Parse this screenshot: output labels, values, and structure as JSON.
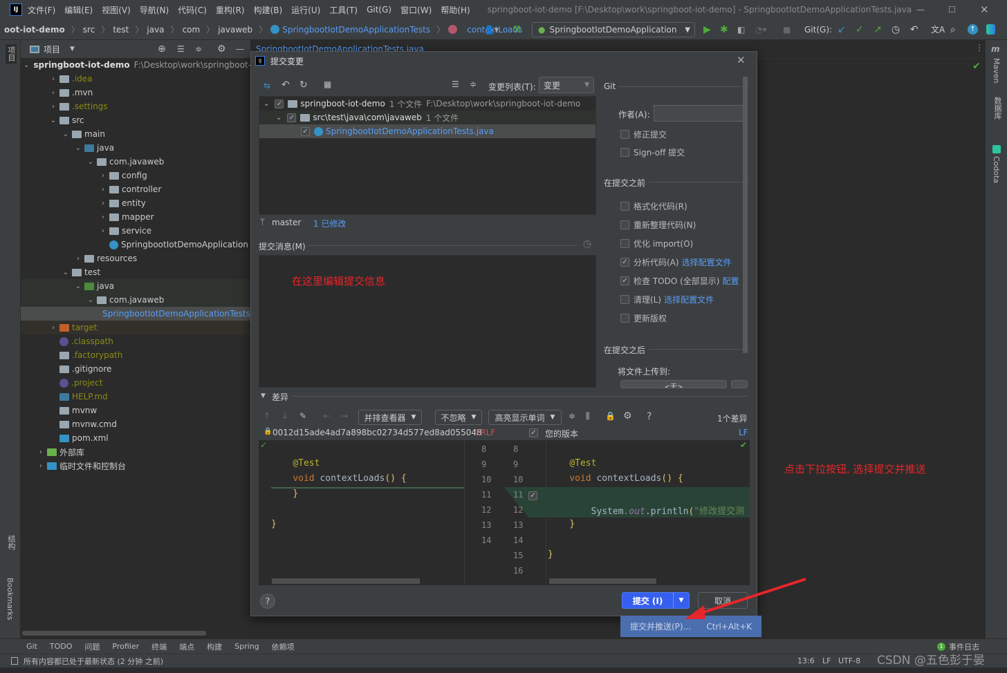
{
  "window": {
    "title": "springboot-iot-demo [F:\\Desktop\\work\\springboot-iot-demo] - SpringbootIotDemoApplicationTests.java",
    "menu": [
      "文件(F)",
      "编辑(E)",
      "视图(V)",
      "导航(N)",
      "代码(C)",
      "重构(R)",
      "构建(B)",
      "运行(U)",
      "工具(T)",
      "Git(G)",
      "窗口(W)",
      "帮助(H)"
    ]
  },
  "breadcrumb": [
    "oot-iot-demo",
    "src",
    "test",
    "java",
    "com",
    "javaweb",
    "SpringbootIotDemoApplicationTests",
    "contextLoads"
  ],
  "toolbar": {
    "run_config": "SpringbootIotDemoApplication",
    "git_label": "Git(G):"
  },
  "left_strip": {
    "project": "项目",
    "structure": "结构",
    "bookmarks": "Bookmarks"
  },
  "right_strip": [
    "Maven",
    "数据库",
    "Codota"
  ],
  "project": {
    "header": "项目",
    "root_name": "springboot-iot-demo",
    "root_path": "F:\\Desktop\\work\\springboot-iot-demo",
    "tree": [
      {
        "l": 1,
        "a": ">",
        "t": ".idea",
        "c": "#8b8b16",
        "i": "folder"
      },
      {
        "l": 1,
        "a": ">",
        "t": ".mvn",
        "c": "#ccc",
        "i": "folder"
      },
      {
        "l": 1,
        "a": ">",
        "t": ".settings",
        "c": "#8b8b16",
        "i": "folder"
      },
      {
        "l": 1,
        "a": "v",
        "t": "src",
        "c": "#ccc",
        "i": "folder"
      },
      {
        "l": 2,
        "a": "v",
        "t": "main",
        "c": "#ccc",
        "i": "folder"
      },
      {
        "l": 3,
        "a": "v",
        "t": "java",
        "c": "#ccc",
        "i": "src-folder"
      },
      {
        "l": 4,
        "a": "v",
        "t": "com.javaweb",
        "c": "#ccc",
        "i": "package"
      },
      {
        "l": 5,
        "a": ">",
        "t": "config",
        "c": "#ccc",
        "i": "package"
      },
      {
        "l": 5,
        "a": ">",
        "t": "controller",
        "c": "#ccc",
        "i": "package"
      },
      {
        "l": 5,
        "a": ">",
        "t": "entity",
        "c": "#ccc",
        "i": "package"
      },
      {
        "l": 5,
        "a": ">",
        "t": "mapper",
        "c": "#ccc",
        "i": "package"
      },
      {
        "l": 5,
        "a": ">",
        "t": "service",
        "c": "#ccc",
        "i": "package"
      },
      {
        "l": 5,
        "a": "",
        "t": "SpringbootIotDemoApplication",
        "c": "#ccc",
        "i": "spring-class"
      },
      {
        "l": 3,
        "a": ">",
        "t": "resources",
        "c": "#ccc",
        "i": "resources-folder"
      },
      {
        "l": 2,
        "a": "v",
        "t": "test",
        "c": "#ccc",
        "i": "folder"
      },
      {
        "l": 3,
        "a": "v",
        "t": "java",
        "c": "#ccc",
        "i": "test-folder"
      },
      {
        "l": 4,
        "a": "v",
        "t": "com.javaweb",
        "c": "#ccc",
        "i": "package"
      },
      {
        "l": 5,
        "a": "",
        "t": "SpringbootIotDemoApplicationTests",
        "c": "#589df6",
        "i": "class"
      },
      {
        "l": 1,
        "a": ">",
        "t": "target",
        "c": "#8b8b16",
        "i": "excluded-folder"
      },
      {
        "l": 1,
        "a": "",
        "t": ".classpath",
        "c": "#8b8b16",
        "i": "eclipse"
      },
      {
        "l": 1,
        "a": "",
        "t": ".factorypath",
        "c": "#8b8b16",
        "i": "file"
      },
      {
        "l": 1,
        "a": "",
        "t": ".gitignore",
        "c": "#ccc",
        "i": "ignore-file"
      },
      {
        "l": 1,
        "a": "",
        "t": ".project",
        "c": "#8b8b16",
        "i": "eclipse"
      },
      {
        "l": 1,
        "a": "",
        "t": "HELP.md",
        "c": "#8b8b16",
        "i": "markdown"
      },
      {
        "l": 1,
        "a": "",
        "t": "mvnw",
        "c": "#ccc",
        "i": "shell"
      },
      {
        "l": 1,
        "a": "",
        "t": "mvnw.cmd",
        "c": "#ccc",
        "i": "file"
      },
      {
        "l": 1,
        "a": "",
        "t": "pom.xml",
        "c": "#ccc",
        "i": "maven"
      },
      {
        "l": 0,
        "a": ">",
        "t": "外部库",
        "c": "#ccc",
        "i": "library"
      },
      {
        "l": 0,
        "a": ">",
        "t": "临时文件和控制台",
        "c": "#ccc",
        "i": "scratch"
      }
    ]
  },
  "editor_tab": "SpringbootIotDemoApplicationTests.java",
  "dialog": {
    "title": "提交变更",
    "changelist_label": "变更列表(T):",
    "changelist_value": "变更",
    "changes": {
      "root": "springboot-iot-demo",
      "root_count": "1 个文件",
      "root_path": "F:\\Desktop\\work\\springboot-iot-demo",
      "dir": "src\\test\\java\\com\\javaweb",
      "dir_count": "1 个文件",
      "file": "SpringbootIotDemoApplicationTests.java"
    },
    "branch": "master",
    "modified": "1 已修改",
    "message_label": "提交消息(M)",
    "git_section": "Git",
    "author_label": "作者(A):",
    "amend": "修正提交",
    "signoff": "Sign-off 提交",
    "before_section": "在提交之前",
    "before_options": [
      {
        "label": "格式化代码(R)",
        "checked": false,
        "link": ""
      },
      {
        "label": "重新整理代码(N)",
        "checked": false,
        "link": ""
      },
      {
        "label": "优化 import(O)",
        "checked": false,
        "link": ""
      },
      {
        "label": "分析代码(A)",
        "checked": true,
        "link": "选择配置文件"
      },
      {
        "label": "检查 TODO (全部显示)",
        "checked": true,
        "link": "配置"
      },
      {
        "label": "清理(L)",
        "checked": false,
        "link": "选择配置文件"
      },
      {
        "label": "更新版权",
        "checked": false,
        "link": ""
      }
    ],
    "after_section": "在提交之后",
    "upload_label": "将文件上传到:",
    "upload_value": "<无>",
    "diff_label": "差异",
    "viewer": "并排查看器",
    "ignore": "不忽略",
    "highlight": "高亮显示单词",
    "diff_count": "1个差异",
    "left_rev": "0012d15ade4ad7a898bc02734d577ed8ad055048",
    "left_eol": "CRLF",
    "right_rev": "您的版本",
    "right_eol": "LF",
    "left_code": [
      {
        "n": "8",
        "t": ""
      },
      {
        "n": "9",
        "t": "    @Test"
      },
      {
        "n": "10",
        "t": "    void contextLoads() {"
      },
      {
        "n": "11",
        "t": "    }"
      },
      {
        "n": "12",
        "t": ""
      },
      {
        "n": "13",
        "t": "}"
      },
      {
        "n": "14",
        "t": ""
      }
    ],
    "right_code": [
      {
        "n": "8",
        "t": ""
      },
      {
        "n": "9",
        "t": "    @Test"
      },
      {
        "n": "10",
        "t": "    void contextLoads() {"
      },
      {
        "n": "11",
        "t": ""
      },
      {
        "n": "12",
        "t": "        System.out.println(\"修改提交测"
      },
      {
        "n": "13",
        "t": "    }"
      },
      {
        "n": "14",
        "t": ""
      },
      {
        "n": "15",
        "t": "}"
      },
      {
        "n": "16",
        "t": ""
      }
    ],
    "commit_btn": "提交 (I)",
    "cancel_btn": "取消",
    "help": "?"
  },
  "popup": {
    "item": "提交并推送(P)...",
    "shortcut": "Ctrl+Alt+K"
  },
  "annotations": {
    "message_hint": "在这里编辑提交信息",
    "dropdown_hint": "点击下拉按钮, 选择提交并推送"
  },
  "bottom_tools": [
    "Git",
    "TODO",
    "问题",
    "Profiler",
    "终端",
    "端点",
    "构建",
    "Spring",
    "依赖项"
  ],
  "event_log": "事件日志",
  "status": {
    "message": "所有内容都已处于最新状态 (2 分钟 之前)",
    "position": "13:6",
    "eol": "LF",
    "encoding": "UTF-8",
    "watermark": "CSDN @五色彭于晏"
  },
  "colors": {
    "accent": "#365880",
    "primary_button": "#365ff0",
    "annotation": "#e6262a",
    "link": "#589df6"
  }
}
